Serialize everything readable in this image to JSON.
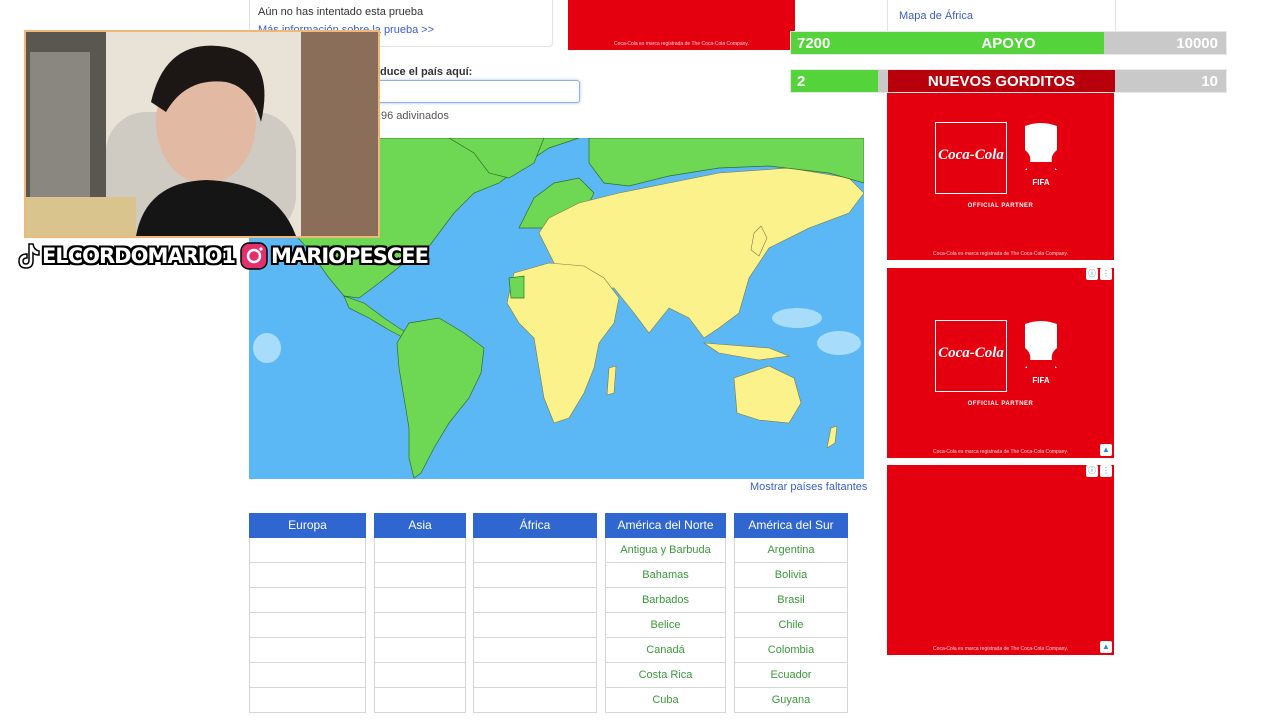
{
  "info": {
    "not_attempted": "Aún no has intentado esta prueba",
    "more_info": "Más información sobre la prueba >>"
  },
  "right_link": "Mapa de África",
  "quiz": {
    "enter_label": "duce el país aquí:",
    "input_value": "",
    "guessed_text": "96 adivinados",
    "show_missing": "Mostrar países faltantes"
  },
  "columns": [
    {
      "header": "Europa",
      "cells": [
        "",
        "",
        "",
        "",
        "",
        "",
        ""
      ]
    },
    {
      "header": "Asia",
      "cells": [
        "",
        "",
        "",
        "",
        "",
        "",
        ""
      ]
    },
    {
      "header": "África",
      "cells": [
        "",
        "",
        "",
        "",
        "",
        "",
        ""
      ]
    },
    {
      "header": "América del Norte",
      "cells": [
        "Antigua y Barbuda",
        "Bahamas",
        "Barbados",
        "Belice",
        "Canadá",
        "Costa Rica",
        "Cuba"
      ]
    },
    {
      "header": "América del Sur",
      "cells": [
        "Argentina",
        "Bolivia",
        "Brasil",
        "Chile",
        "Colombia",
        "Ecuador",
        "Guyana"
      ]
    }
  ],
  "ads": {
    "brand_text": "Coca-Cola",
    "partner_text": "OFFICIAL PARTNER",
    "fifa_text": "FIFA",
    "disclaimer": "Coca-Cola es marca registrada de The Coca-Cola Company."
  },
  "overlay": {
    "apoyo": {
      "left": "7200",
      "label": "APOYO",
      "right": "10000",
      "progress": 0.72
    },
    "gorditos": {
      "left": "2",
      "label": "NUEVOS GORDITOS",
      "right": "10",
      "progress": 0.2
    }
  },
  "socials": {
    "tiktok": "ELCORDOMARIO1",
    "instagram": "MARIOPESCEE"
  },
  "colors": {
    "table_header": "#2f66d0",
    "ocean": "#5bb8f5",
    "land_guessed": "#6ed854",
    "land_unguessed": "#fbf28c",
    "ad_red": "#e4000f",
    "bar_green": "#54d43a",
    "bar_red": "#b8000c"
  }
}
